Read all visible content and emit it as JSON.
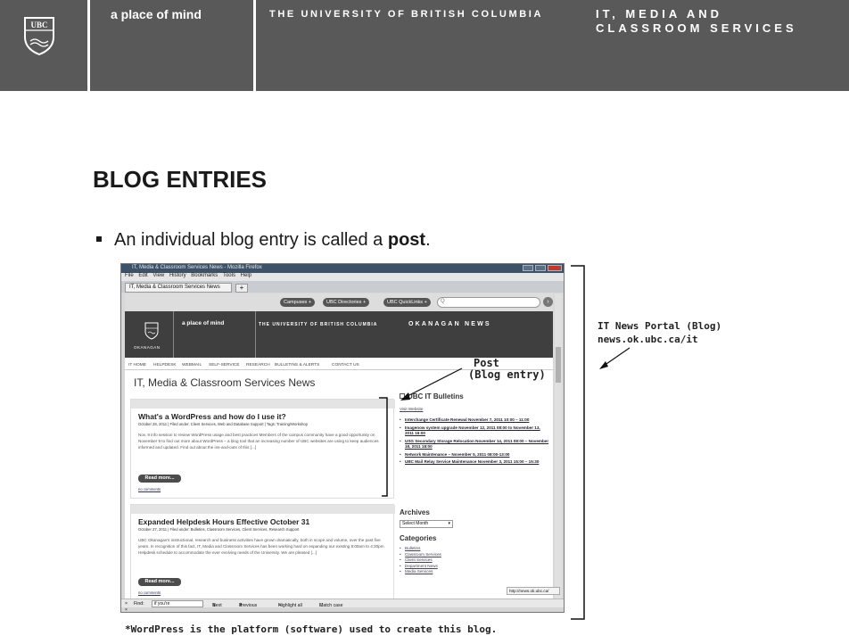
{
  "slide_header": {
    "tagline": "a place of mind",
    "university": "THE UNIVERSITY OF BRITISH COLUMBIA",
    "department_line1": "IT, MEDIA AND",
    "department_line2": "CLASSROOM SERVICES",
    "logo_text": "UBC"
  },
  "slide": {
    "title": "BLOG ENTRIES",
    "bullet_prefix": "An individual blog entry is called a ",
    "bullet_bold": "post",
    "bullet_suffix": ".",
    "footnote": "*WordPress is the platform (software) used to create this blog."
  },
  "annotations": {
    "post_label_line1": "Post",
    "post_label_line2": "(Blog entry)",
    "portal_label_line1": "IT News Portal (Blog)",
    "portal_label_line2": "news.ok.ubc.ca/it"
  },
  "browser": {
    "window_title": "IT, Media & Classroom Services News - Mozilla Firefox",
    "menu": [
      "File",
      "Edit",
      "View",
      "History",
      "Bookmarks",
      "Tools",
      "Help"
    ],
    "tab_label": "IT, Media & Classroom Services News",
    "new_tab": "+",
    "top_pills": [
      "Campuses +",
      "UBC Directories +",
      "UBC QuickLinks +"
    ],
    "search_placeholder": "Q",
    "site_header": {
      "tagline": "a place of mind",
      "university": "THE UNIVERSITY OF BRITISH COLUMBIA",
      "okanagan_news": "OKANAGAN NEWS",
      "logo_caption": "OKANAGAN"
    },
    "nav": [
      "IT HOME",
      "HELPDESK",
      "WEBMAIL",
      "SELF-SERVICE",
      "RESEARCH",
      "BULLETINS & ALERTS",
      "CONTACT US"
    ],
    "page_title": "IT, Media & Classroom Services News",
    "posts": [
      {
        "title": "What's a WordPress and how do I use it?",
        "meta": "October 28, 2011 | Filed under: Client Services, Web and Database Support | Tags: Training/Workshop",
        "excerpt": "Nov. 9 info session to review WordPress usage and best practices Members of the campus community have a good opportunity on November 9 to find out more about WordPress – a blog tool that an increasing number of UBC websites are using to keep audiences informed and updated. Find out about the ins-and-outs of this [...]",
        "read_more": "Read more...",
        "comments": "no comments"
      },
      {
        "title": "Expanded Helpdesk Hours Effective October 31",
        "meta": "October 27, 2011 | Filed under: Bulletins, Classroom Services, Client Services, Research Support",
        "excerpt": "UBC Okanagan's instructional, research and business activities have grown dramatically, both in scope and volume, over the past five years. In recognition of this fact, IT, Media and Classroom Services has been working hard on expanding our existing 8:00am to 4:30pm Helpdesk schedule to accommodate the ever evolving needs of the University. We are pleased [...]",
        "read_more": "Read more...",
        "comments": "no comments"
      }
    ],
    "sidebar": {
      "bulletins_title": "UBC IT Bulletins",
      "visit_website": "Visit Website",
      "bulletins": [
        "Interchange Certificate Renewal November 7, 2011 10:00 – 11:00",
        "Imagenow system upgrade November 12, 2011 08:00 to November 13, 2011 16:00",
        "USG Secondary Storage Relocation November 14, 2011 08:00 – November 18, 2011 18:00",
        "Network Maintenance – November 5, 2011 08:00-13:00",
        "UBC Mail Relay Service Maintenance November 3, 2011 15:00 – 15:30"
      ],
      "archives_title": "Archives",
      "archives_select": "Select Month",
      "categories_title": "Categories",
      "categories": [
        "Bulletins",
        "Classroom Services",
        "Client Services",
        "Department News",
        "Media Services"
      ]
    },
    "status_url": "http://news.ok.ubc.ca/",
    "find_bar": {
      "close": "×",
      "label": "Find:",
      "value": "if you're",
      "next": "Next",
      "previous": "Previous",
      "highlight": "Highlight all",
      "match_case": "Match case"
    },
    "status_close": "×"
  }
}
